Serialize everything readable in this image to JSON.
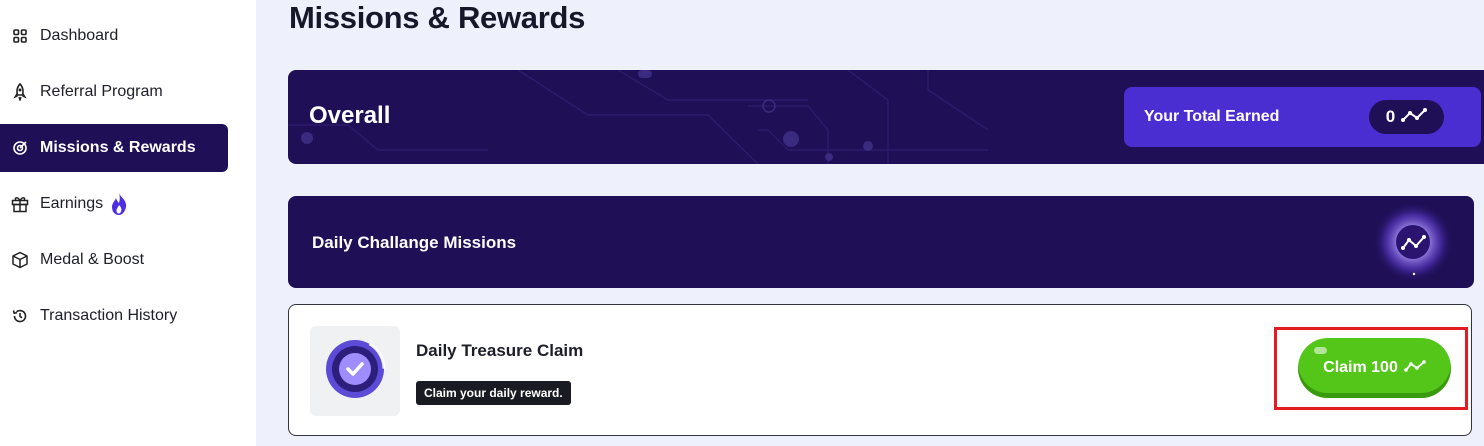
{
  "sidebar": {
    "items": [
      {
        "label": "Dashboard",
        "icon": "grid-icon",
        "active": false
      },
      {
        "label": "Referral Program",
        "icon": "rocket-icon",
        "active": false
      },
      {
        "label": "Missions & Rewards",
        "icon": "target-icon",
        "active": true
      },
      {
        "label": "Earnings",
        "icon": "gift-icon",
        "active": false,
        "badge_icon": "fire-icon"
      },
      {
        "label": "Medal & Boost",
        "icon": "cube-icon",
        "active": false
      },
      {
        "label": "Transaction History",
        "icon": "history-icon",
        "active": false
      }
    ]
  },
  "main": {
    "title": "Missions & Rewards",
    "overall": {
      "title": "Overall",
      "earned_label": "Your Total Earned",
      "earned_value": "0",
      "earned_icon": "token-icon"
    },
    "daily": {
      "title": "Daily Challange Missions"
    },
    "missions": [
      {
        "title": "Daily Treasure Claim",
        "description": "Claim your daily reward.",
        "button_label": "Claim 100",
        "button_icon": "token-icon"
      }
    ]
  },
  "colors": {
    "sidebar_active": "#1f0f57",
    "banner": "#1f0f57",
    "earned_box": "#4a2ed2",
    "claim_button": "#54c61a",
    "highlight": "#e31b23"
  }
}
